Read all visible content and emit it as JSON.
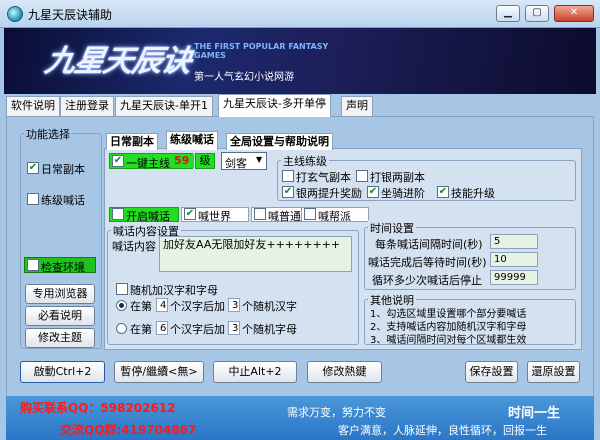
{
  "window": {
    "title": "九星天辰诀辅助",
    "min": "▁",
    "max": "▢",
    "close": "✕"
  },
  "banner": {
    "logo": "九星天辰诀",
    "slogan_en": "THE FIRST POPULAR FANTASY GAMES",
    "slogan_cn": "第一人气玄幻小说网游"
  },
  "main_tabs": [
    "软件说明",
    "注册登录",
    "九星天辰诀-单开1",
    "九星天辰诀-多开单停",
    "声明"
  ],
  "func_select": {
    "title": "功能选择",
    "items": [
      {
        "label": "日常副本",
        "checked": true
      },
      {
        "label": "练级喊话",
        "checked": false
      }
    ],
    "check_env": {
      "label": "检查环境",
      "checked": false
    },
    "buttons": [
      "专用浏览器",
      "必看说明",
      "修改主题"
    ]
  },
  "inner_tabs": [
    "日常副本",
    "练级喊话",
    "全局设置与帮助说明"
  ],
  "leveling": {
    "one_key_label": "一键主线",
    "one_key_checked": true,
    "level_value": "59",
    "level_unit": "级",
    "class_value": "剑客",
    "group_title": "主线练级",
    "options": [
      {
        "label": "打玄气副本",
        "checked": false
      },
      {
        "label": "打银两副本",
        "checked": false
      },
      {
        "label": "银两提升奖励",
        "checked": true
      },
      {
        "label": "坐骑进阶",
        "checked": true
      },
      {
        "label": "技能升级",
        "checked": true
      }
    ]
  },
  "shout": {
    "enable": {
      "label": "开启喊话",
      "checked": false
    },
    "channels": [
      {
        "label": "喊世界",
        "checked": true
      },
      {
        "label": "喊普通",
        "checked": false
      },
      {
        "label": "喊帮派",
        "checked": false
      }
    ],
    "content_group_title": "喊话内容设置",
    "content_label": "喊话内容",
    "content_value": "加好友AA无限加好友++++++++",
    "random_label": "随机加汉字和字母",
    "random_checked": false,
    "rows": [
      {
        "pre": "在第",
        "n1": "4",
        "mid": "个汉字后加",
        "n2": "3",
        "post": "个随机汉字",
        "selected": true
      },
      {
        "pre": "在第",
        "n1": "6",
        "mid": "个汉字后加",
        "n2": "3",
        "post": "个随机字母",
        "selected": false
      }
    ]
  },
  "time_settings": {
    "title": "时间设置",
    "rows": [
      {
        "label": "每条喊话间隔时间(秒)",
        "value": "5"
      },
      {
        "label": "喊话完成后等待时间(秒)",
        "value": "10"
      },
      {
        "label": "循环多少次喊话后停止",
        "value": "99999"
      }
    ]
  },
  "other_notes": {
    "title": "其他说明",
    "lines": [
      "1、勾选区域里设置哪个部分要喊话",
      "2、支持喊话内容加随机汉字和字母",
      "3、喊话间隔时间对每个区域都生效"
    ]
  },
  "action_buttons": [
    "啟動Ctrl+2",
    "暫停/繼續<無>",
    "中止Alt+2",
    "修改熱鍵",
    "保存設置",
    "還原設置"
  ],
  "footer": {
    "buy_contact": "购买联系QQ：598202612",
    "group": "交流QQ群:419704867",
    "motto1": "需求万变，努力不变",
    "motto2": "时间一生",
    "motto3": "客户满意，人脉延伸，良性循环，回报一生"
  },
  "colors": {
    "accent_green": "#22cc22",
    "footer_red": "#ff1a1a",
    "bg": "#a7c6e6"
  }
}
